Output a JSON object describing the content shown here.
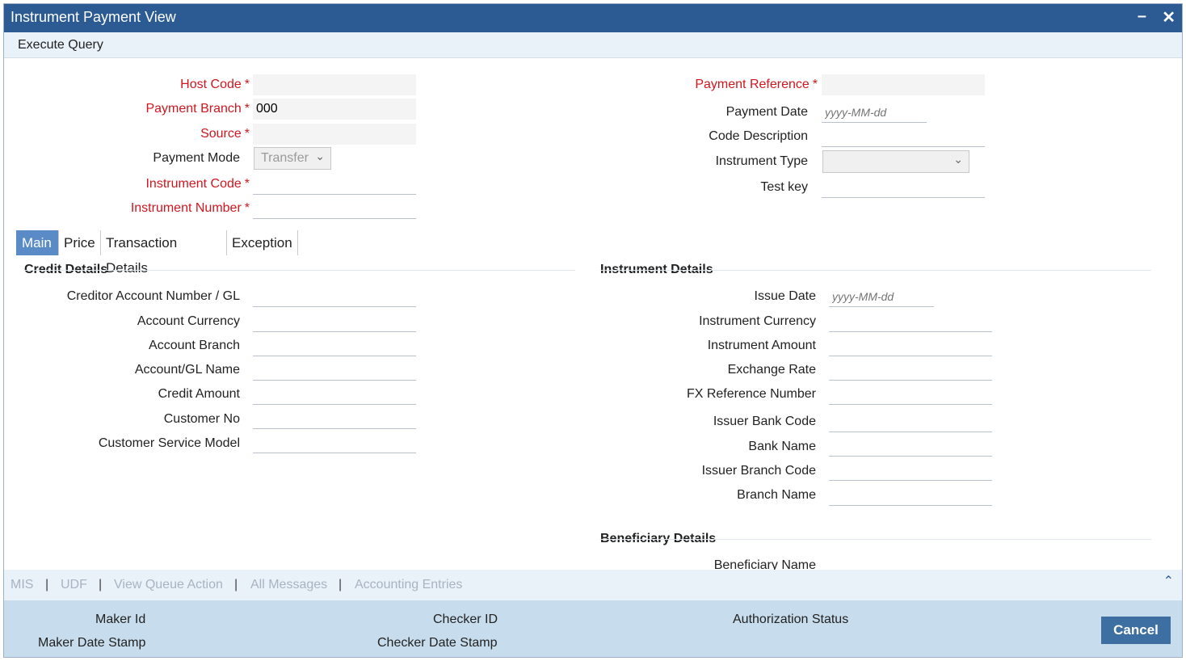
{
  "window": {
    "title": "Instrument Payment View"
  },
  "toolbar": {
    "execute_query": "Execute Query"
  },
  "header": {
    "host_code": {
      "label": "Host Code",
      "value": ""
    },
    "payment_branch": {
      "label": "Payment Branch",
      "value": "000"
    },
    "source": {
      "label": "Source",
      "value": ""
    },
    "payment_mode": {
      "label": "Payment Mode",
      "value": "Transfer"
    },
    "instrument_code": {
      "label": "Instrument Code",
      "value": ""
    },
    "instrument_number": {
      "label": "Instrument Number",
      "value": ""
    },
    "payment_reference": {
      "label": "Payment Reference",
      "value": ""
    },
    "payment_date": {
      "label": "Payment Date",
      "placeholder": "yyyy-MM-dd"
    },
    "code_description": {
      "label": "Code Description",
      "value": ""
    },
    "instrument_type": {
      "label": "Instrument Type",
      "value": ""
    },
    "test_key": {
      "label": "Test key",
      "value": ""
    },
    "required_mark": "*"
  },
  "tabs": [
    "Main",
    "Price",
    "Transaction Details",
    "Exception"
  ],
  "credit_details": {
    "title": "Credit Details",
    "fields": [
      "Creditor Account Number / GL",
      "Account Currency",
      "Account Branch",
      "Account/GL Name",
      "Credit Amount",
      "Customer No",
      "Customer Service Model"
    ]
  },
  "instrument_details": {
    "title": "Instrument Details",
    "issue_date": {
      "label": "Issue Date",
      "placeholder": "yyyy-MM-dd"
    },
    "fields": [
      "Instrument Currency",
      "Instrument Amount",
      "Exchange Rate",
      "FX Reference Number",
      "Issuer Bank Code",
      "Bank Name",
      "Issuer Branch Code",
      "Branch Name"
    ]
  },
  "beneficiary_details": {
    "title": "Beneficiary Details",
    "fields": [
      "Beneficiary Name"
    ]
  },
  "footer_links": [
    "MIS",
    "UDF",
    "View Queue Action",
    "All Messages",
    "Accounting Entries"
  ],
  "footer_sep": "|",
  "audit": {
    "maker_id": "Maker Id",
    "maker_date_stamp": "Maker Date Stamp",
    "checker_id": "Checker ID",
    "checker_date_stamp": "Checker Date Stamp",
    "authorization_status": "Authorization Status",
    "cancel": "Cancel"
  },
  "icons": {
    "minimize": "minimize-icon",
    "close": "close-icon",
    "dropdown": "chevron-down-icon",
    "scroll_up": "chevron-up-icon"
  },
  "colors": {
    "titlebar": "#2c5a92",
    "required": "#d0161e",
    "tab_active": "#5a8bc6",
    "audit_bar": "#c7dcec",
    "cancel_button": "#3d6fa3"
  }
}
